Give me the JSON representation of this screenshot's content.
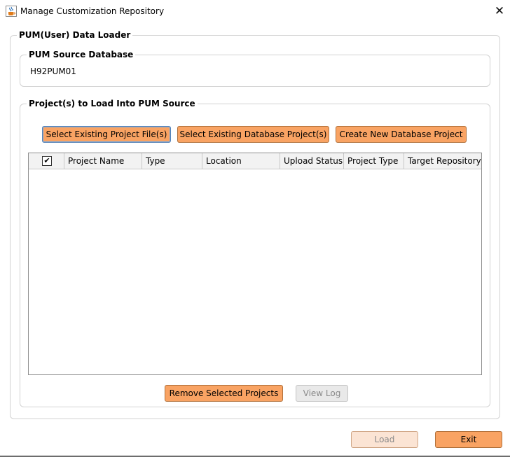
{
  "window": {
    "title": "Manage Customization Repository",
    "icon": "java-cup-icon",
    "close_glyph": "✕"
  },
  "loader": {
    "legend": "PUM(User) Data Loader"
  },
  "source_db": {
    "legend": "PUM Source Database",
    "value": "H92PUM01"
  },
  "projects": {
    "legend": "Project(s) to Load Into PUM Source",
    "buttons": {
      "select_file": "Select Existing Project File(s)",
      "select_db": "Select Existing Database Project(s)",
      "create_new": "Create New Database Project"
    },
    "table": {
      "select_all_checked": true,
      "check_glyph": "✔",
      "columns": [
        "Project Name",
        "Type",
        "Location",
        "Upload Status",
        "Project Type",
        "Target Repository"
      ],
      "rows": []
    },
    "remove_label": "Remove Selected Projects",
    "view_log_label": "View Log"
  },
  "footer": {
    "load_label": "Load",
    "exit_label": "Exit"
  },
  "colors": {
    "button_accent": "#f9a363",
    "focus_border": "#5583b8"
  }
}
